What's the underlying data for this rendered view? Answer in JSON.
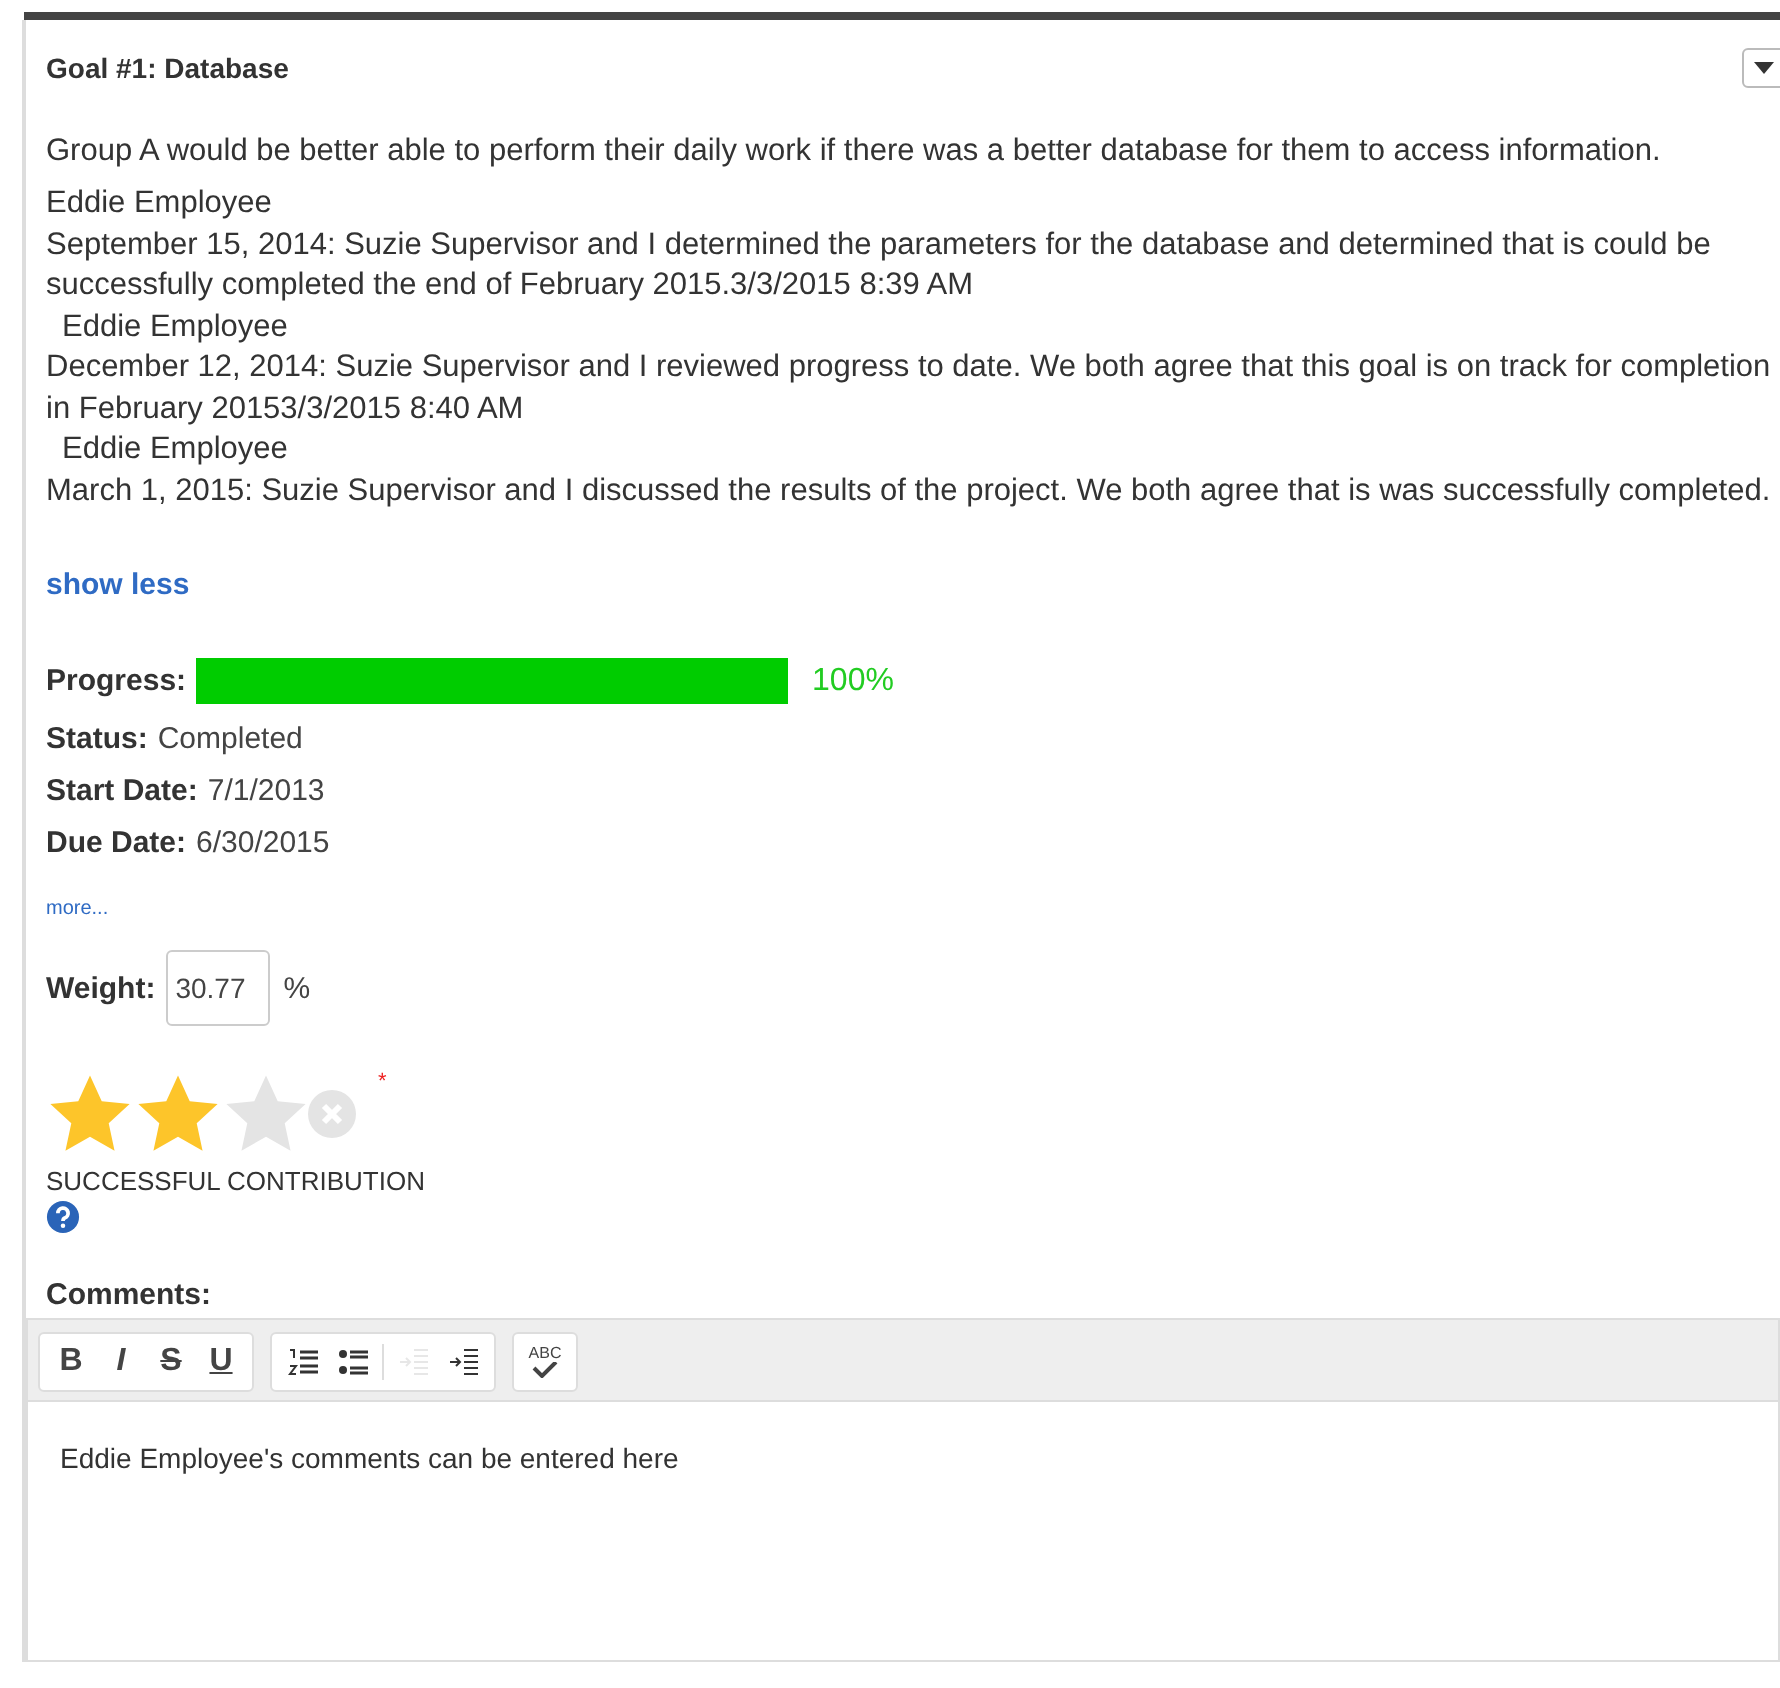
{
  "goal": {
    "title": "Goal #1: Database",
    "description": "Group A would be better able to perform their daily work if there was a better database for them to access information.",
    "history": [
      {
        "kind": "author",
        "text": "Eddie Employee",
        "indented": false
      },
      {
        "kind": "note",
        "text": "September 15, 2014: Suzie Supervisor and I determined the parameters for the database and determined that is could be successfully completed the end of February 2015.3/3/2015 8:39 AM"
      },
      {
        "kind": "author",
        "text": "Eddie Employee",
        "indented": true
      },
      {
        "kind": "note",
        "text": "December 12, 2014: Suzie Supervisor and I reviewed progress to date. We both agree that this goal is on track for completion in February 20153/3/2015 8:40 AM"
      },
      {
        "kind": "author",
        "text": "Eddie Employee",
        "indented": true
      },
      {
        "kind": "note",
        "text": "March 1, 2015: Suzie Supervisor and I discussed the results of the project. We both agree that is was successfully completed."
      }
    ],
    "show_less": "show less",
    "progress": {
      "label": "Progress:",
      "level": 1.0,
      "reading": "100%"
    },
    "fields": [
      {
        "label": "Status:",
        "value": "Completed"
      },
      {
        "label": "Start Date:",
        "value": "7/1/2013"
      },
      {
        "label": "Due Date:",
        "value": "6/30/2015"
      }
    ],
    "more": "more...",
    "weight": {
      "label": "Weight:",
      "value": "30.77",
      "unit": "%"
    },
    "rating": {
      "stars": 2,
      "required_mark": "*",
      "label": "SUCCESSFUL CONTRIBUTION"
    },
    "comments": {
      "label": "Comments:",
      "toolbar": [
        [
          {
            "kind": "bold",
            "text": "B",
            "disabled": false
          },
          {
            "kind": "italic",
            "text": "I",
            "disabled": false
          },
          {
            "kind": "strike",
            "text": "S",
            "disabled": false
          },
          {
            "kind": "underline",
            "text": "U",
            "disabled": false
          }
        ],
        [
          {
            "kind": "numbered-list",
            "disabled": false
          },
          {
            "kind": "bullet-list",
            "disabled": false
          },
          {
            "kind": "outdent",
            "disabled": true
          },
          {
            "kind": "indent",
            "disabled": false
          }
        ],
        [
          {
            "kind": "spellcheck",
            "text": "ABC",
            "disabled": false
          }
        ]
      ],
      "value": "Eddie Employee's comments can be entered here"
    }
  }
}
